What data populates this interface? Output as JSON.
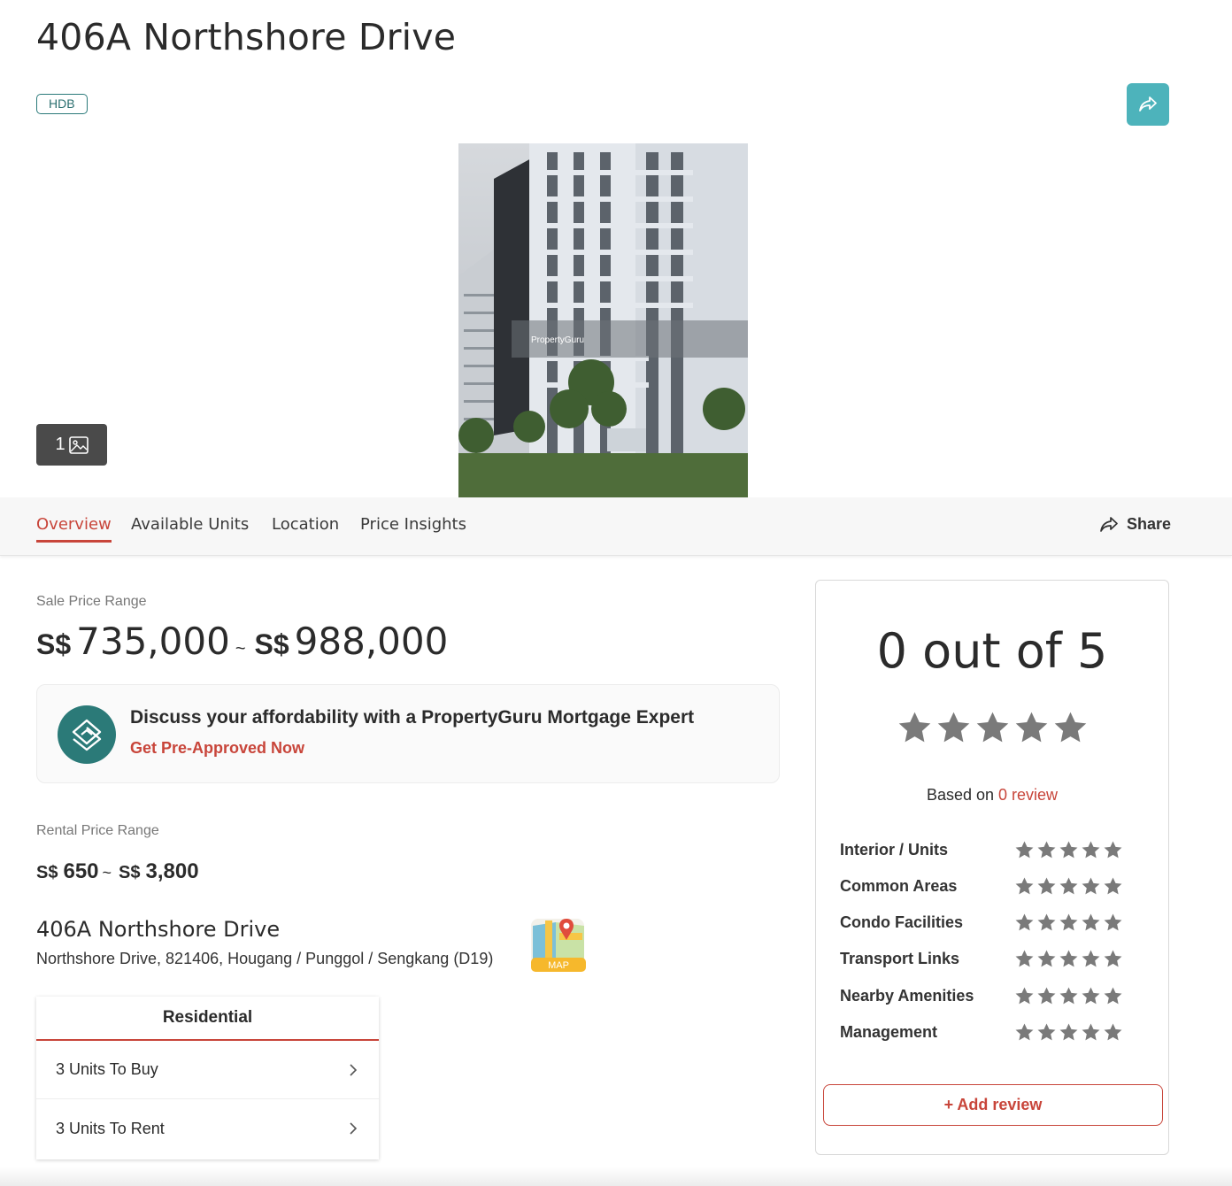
{
  "header": {
    "title": "406A Northshore Drive",
    "badge": "HDB"
  },
  "gallery": {
    "photo_count": "1",
    "watermark": "PropertyGuru"
  },
  "tabs": [
    {
      "label": "Overview",
      "active": true
    },
    {
      "label": "Available Units",
      "active": false
    },
    {
      "label": "Location",
      "active": false
    },
    {
      "label": "Price Insights",
      "active": false
    }
  ],
  "share_label": "Share",
  "sale": {
    "label": "Sale Price Range",
    "currency": "S$",
    "min": "735,000",
    "separator": "~",
    "max": "988,000"
  },
  "mortgage": {
    "title": "Discuss your affordability with a PropertyGuru Mortgage Expert",
    "link": "Get Pre-Approved Now"
  },
  "rental": {
    "label": "Rental Price Range",
    "currency": "S$",
    "min": "650",
    "separator": "~",
    "max": "3,800"
  },
  "address": {
    "title": "406A Northshore Drive",
    "line": "Northshore Drive, 821406, Hougang / Punggol / Sengkang (D19)",
    "map_label": "MAP"
  },
  "residential": {
    "heading": "Residential",
    "rows": [
      {
        "label": "3 Units To Buy"
      },
      {
        "label": "3 Units To Rent"
      }
    ]
  },
  "reviews": {
    "score_text": "0 out of 5",
    "rating": 0,
    "max_rating": 5,
    "based_prefix": "Based on",
    "count_text": "0 review",
    "categories": [
      {
        "label": "Interior / Units",
        "rating": 0
      },
      {
        "label": "Common Areas",
        "rating": 0
      },
      {
        "label": "Condo Facilities",
        "rating": 0
      },
      {
        "label": "Transport Links",
        "rating": 0
      },
      {
        "label": "Nearby Amenities",
        "rating": 0
      },
      {
        "label": "Management",
        "rating": 0
      }
    ],
    "add_label": "+ Add review"
  },
  "colors": {
    "accent": "#c8453a",
    "teal": "#4db3bb",
    "star": "#7a7a7a"
  }
}
